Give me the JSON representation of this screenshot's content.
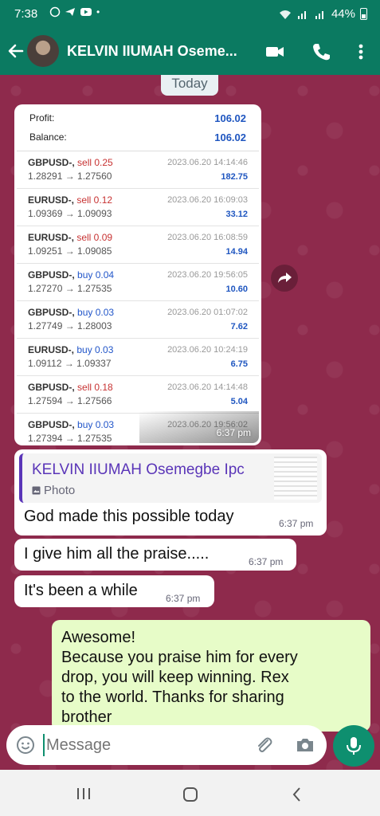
{
  "status_bar": {
    "time": "7:38",
    "dot": "•",
    "battery": "44%"
  },
  "header": {
    "contact_name": "KELVIN IIUMAH Oseme..."
  },
  "chat": {
    "day_label": "Today",
    "screenshot": {
      "profit_label": "Profit:",
      "profit_value": "106.02",
      "balance_label": "Balance:",
      "balance_value": "106.02",
      "trades": [
        {
          "symbol": "GBPUSD-, ",
          "side": "sell 0.25",
          "prices": "1.28291 → 1.27560",
          "date": "2023.06.20 14:14:46",
          "profit": "182.75"
        },
        {
          "symbol": "EURUSD-, ",
          "side": "sell 0.12",
          "prices": "1.09369 → 1.09093",
          "date": "2023.06.20 16:09:03",
          "profit": "33.12"
        },
        {
          "symbol": "EURUSD-, ",
          "side": "sell 0.09",
          "prices": "1.09251 → 1.09085",
          "date": "2023.06.20 16:08:59",
          "profit": "14.94"
        },
        {
          "symbol": "GBPUSD-, ",
          "side": "buy 0.04",
          "prices": "1.27270 → 1.27535",
          "date": "2023.06.20 19:56:05",
          "profit": "10.60"
        },
        {
          "symbol": "GBPUSD-, ",
          "side": "buy 0.03",
          "prices": "1.27749 → 1.28003",
          "date": "2023.06.20 01:07:02",
          "profit": "7.62"
        },
        {
          "symbol": "EURUSD-, ",
          "side": "buy 0.03",
          "prices": "1.09112 → 1.09337",
          "date": "2023.06.20 10:24:19",
          "profit": "6.75"
        },
        {
          "symbol": "GBPUSD-, ",
          "side": "sell 0.18",
          "prices": "1.27594 → 1.27566",
          "date": "2023.06.20 14:14:48",
          "profit": "5.04"
        },
        {
          "symbol": "GBPUSD-, ",
          "side": "buy 0.03",
          "prices": "1.27394 → 1.27535",
          "date": "2023.06.20 19:56:02",
          "profit": ""
        }
      ],
      "time": "6:37 pm"
    },
    "reply_message": {
      "quote_name": "KELVIN IIUMAH Osemegbe Ipc",
      "quote_type": "Photo",
      "text": "God made this possible today",
      "time": "6:37 pm"
    },
    "message2": {
      "text": "I give him all the praise.....",
      "time": "6:37 pm"
    },
    "message3": {
      "text": "It's been a while",
      "time": "6:37 pm"
    },
    "outgoing": {
      "lines": [
        "Awesome!",
        "Because you praise him for every",
        "drop, you will keep winning. Rex",
        "to the world. Thanks for sharing",
        "brother"
      ]
    }
  },
  "compose": {
    "placeholder": "Message"
  },
  "colors": {
    "header": "#0b7a61",
    "chat_bg": "#8e2a4c",
    "outgoing": "#e7fcc8",
    "quote_accent": "#5a35b8",
    "mic": "#0e8f6f"
  },
  "icons": [
    "back-arrow-icon",
    "video-call-icon",
    "phone-icon",
    "more-icon",
    "forward-icon",
    "emoji-icon",
    "attach-icon",
    "camera-icon",
    "mic-icon",
    "recent-apps-icon",
    "home-icon",
    "back-nav-icon"
  ]
}
